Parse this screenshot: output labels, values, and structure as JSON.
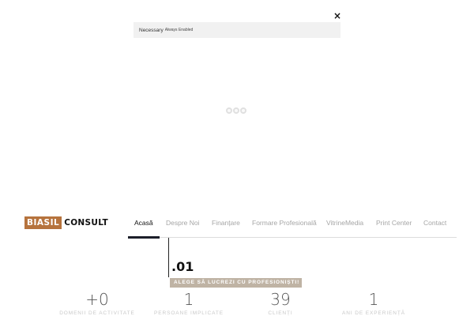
{
  "consent": {
    "close_glyph": "×",
    "category_name": "Necessary",
    "category_status": "Always Enabled"
  },
  "brand": {
    "logo_box_text": "BIASIL",
    "logo_text": "CONSULT",
    "accent_color": "#b6733d"
  },
  "nav": {
    "items": [
      {
        "label": "Acasă",
        "active": true
      },
      {
        "label": "Despre Noi",
        "active": false
      },
      {
        "label": "Finanțare",
        "active": false
      },
      {
        "label": "Formare Profesională",
        "active": false
      },
      {
        "label": "VitrineMedia",
        "active": false
      },
      {
        "label": "Print Center",
        "active": false
      },
      {
        "label": "Contact",
        "active": false
      }
    ]
  },
  "section": {
    "number": ".01",
    "tagline": "ALEGE SĂ LUCREZI CU PROFESIONIȘTI!"
  },
  "stats": [
    {
      "value": "+0",
      "label": "Domenii de activitate"
    },
    {
      "value": "1",
      "label": "Persoane implicate"
    },
    {
      "value": "39",
      "label": "Clienți"
    },
    {
      "value": "1",
      "label": "Ani de experiență"
    }
  ]
}
